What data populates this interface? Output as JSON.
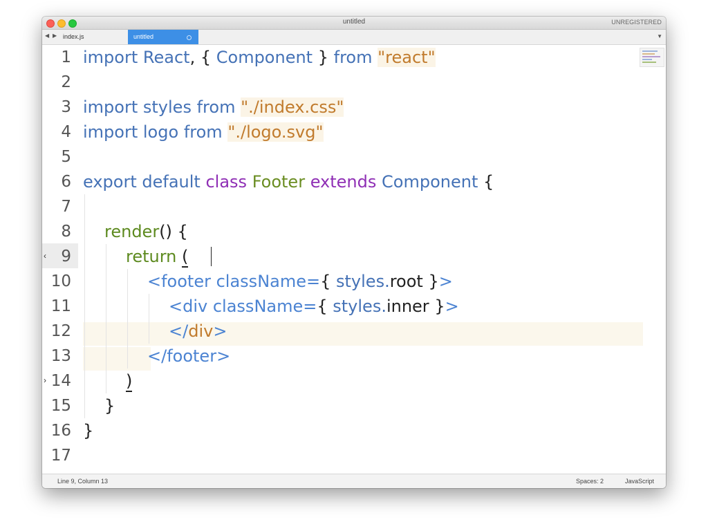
{
  "window": {
    "title": "untitled",
    "registration": "UNREGISTERED"
  },
  "tabs": [
    {
      "label": "index.js",
      "active": false
    },
    {
      "label": "untitled",
      "active": true
    }
  ],
  "editor": {
    "line_numbers": [
      "1",
      "2",
      "3",
      "4",
      "5",
      "6",
      "7",
      "8",
      "9",
      "10",
      "11",
      "12",
      "13",
      "14",
      "15",
      "16",
      "17"
    ],
    "lines": {
      "l1": {
        "import": "import",
        "react": "React",
        "comma": ", ",
        "ob": "{ ",
        "component": "Component",
        "cb": " } ",
        "from": "from",
        "sp": " ",
        "str": "\"react\""
      },
      "l3": {
        "import": "import",
        "styles": "styles",
        "from": "from",
        "str": "\"./index.css\""
      },
      "l4": {
        "import": "import",
        "logo": "logo",
        "from": "from",
        "str": "\"./logo.svg\""
      },
      "l6": {
        "export": "export",
        "default": "default",
        "class": "class",
        "name": "Footer",
        "extends": "extends",
        "base": "Component",
        "brace": "{"
      },
      "l8": {
        "fn": "render",
        "rest": "() {"
      },
      "l9": {
        "return": "return",
        "paren": "("
      },
      "l10": {
        "open": "<",
        "tag": "footer",
        "attr": "className=",
        "ob": "{ ",
        "obj": "styles.",
        "prop": "root",
        "cb": " }",
        "close": ">"
      },
      "l11": {
        "open": "<",
        "tag": "div",
        "attr": "className=",
        "ob": "{ ",
        "obj": "styles.",
        "prop": "inner",
        "cb": " }",
        "close": ">"
      },
      "l12": {
        "open": "</",
        "tag": "div",
        "close": ">"
      },
      "l13": {
        "open": "</",
        "tag": "footer",
        "close": ">"
      },
      "l14": {
        "paren": ")"
      },
      "l15": {
        "brace": "}"
      },
      "l16": {
        "brace": "}"
      }
    }
  },
  "status": {
    "position": "Line 9, Column 13",
    "indentation": "Spaces: 2",
    "syntax": "JavaScript"
  },
  "colors": {
    "keyword_blue": "#4572b6",
    "keyword_purple": "#8f2fb5",
    "string": "#c17b2d",
    "function": "#5d8a1f",
    "tag": "#4b83d2",
    "active_tab": "#3d8fe6"
  }
}
